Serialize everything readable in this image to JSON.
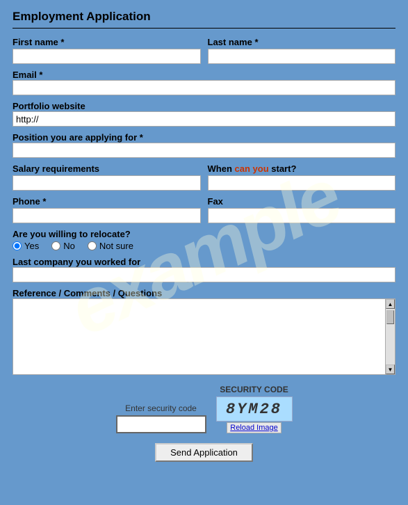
{
  "page": {
    "background_color": "#6699cc",
    "watermark_text": "example"
  },
  "form": {
    "title": "Employment Application",
    "fields": {
      "first_name": {
        "label": "First name",
        "required": true,
        "placeholder": "",
        "value": ""
      },
      "last_name": {
        "label": "Last name",
        "required": true,
        "placeholder": "",
        "value": ""
      },
      "email": {
        "label": "Email",
        "required": true,
        "placeholder": "",
        "value": ""
      },
      "portfolio": {
        "label": "Portfolio website",
        "required": false,
        "placeholder": "",
        "value": "http://"
      },
      "position": {
        "label": "Position you are applying for",
        "required": true,
        "placeholder": "",
        "value": ""
      },
      "salary": {
        "label": "Salary requirements",
        "required": false,
        "placeholder": "",
        "value": ""
      },
      "when_start": {
        "label": "When",
        "label_highlight": "can you",
        "label_end": "start?",
        "required": false,
        "placeholder": "",
        "value": ""
      },
      "phone": {
        "label": "Phone",
        "required": true,
        "placeholder": "",
        "value": ""
      },
      "fax": {
        "label": "Fax",
        "required": false,
        "placeholder": "",
        "value": ""
      },
      "relocate": {
        "label": "Are you willing to relocate?",
        "options": [
          "Yes",
          "No",
          "Not sure"
        ],
        "selected": "Yes"
      },
      "last_company": {
        "label": "Last company you worked for",
        "required": false,
        "placeholder": "",
        "value": ""
      },
      "comments": {
        "label": "Reference / Comments / Questions",
        "required": false,
        "placeholder": "",
        "value": ""
      }
    },
    "security": {
      "enter_code_label": "Enter security code",
      "security_code_label": "SECURITY CODE",
      "captcha_value": "8YM28",
      "reload_label": "Reload Image"
    },
    "submit_label": "Send Application"
  }
}
